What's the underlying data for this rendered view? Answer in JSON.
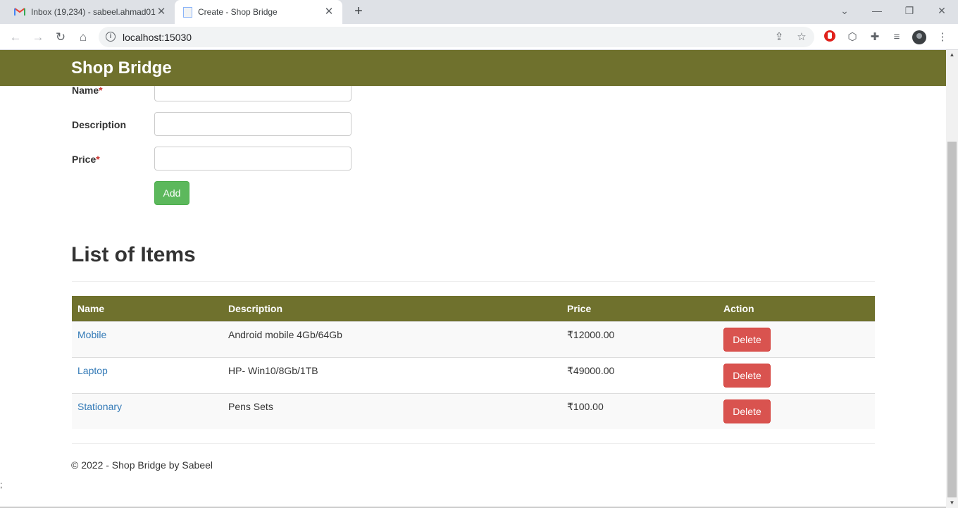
{
  "browser": {
    "tabs": [
      {
        "title": "Inbox (19,234) - sabeel.ahmad01",
        "icon": "gmail-icon"
      },
      {
        "title": "Create - Shop Bridge",
        "icon": "document-icon"
      }
    ],
    "close_glyph": "✕",
    "new_tab_glyph": "+",
    "url": "localhost:15030"
  },
  "page": {
    "brand": "Shop Bridge",
    "form": {
      "name_label": "Name",
      "description_label": "Description",
      "price_label": "Price",
      "required_mark": "*",
      "add_label": "Add"
    },
    "list_heading": "List of Items",
    "table": {
      "headers": [
        "Name",
        "Description",
        "Price",
        "Action"
      ],
      "rows": [
        {
          "name": "Mobile",
          "description": "Android mobile 4Gb/64Gb",
          "price": "₹12000.00",
          "action": "Delete"
        },
        {
          "name": "Laptop",
          "description": "HP- Win10/8Gb/1TB",
          "price": "₹49000.00",
          "action": "Delete"
        },
        {
          "name": "Stationary",
          "description": "Pens Sets",
          "price": "₹100.00",
          "action": "Delete"
        }
      ]
    },
    "footer": "© 2022 - Shop Bridge by Sabeel",
    "stray_text": ";"
  },
  "colors": {
    "navbar": "#6f712d",
    "add_button": "#5cb85c",
    "delete_button": "#d9534f",
    "link": "#337ab7"
  }
}
